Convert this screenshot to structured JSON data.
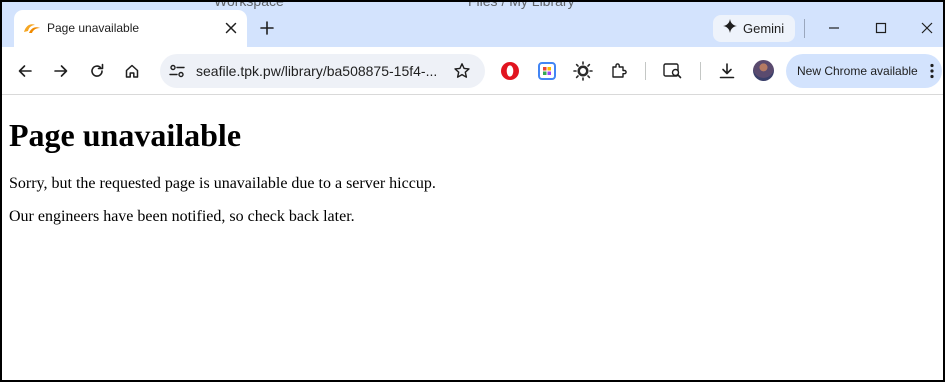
{
  "browser": {
    "background_tabs": [
      "Workspace",
      "Files / My Library"
    ],
    "active_tab": {
      "title": "Page unavailable",
      "favicon": "seafile-icon"
    },
    "gemini_label": "Gemini",
    "address_bar": {
      "url": "seafile.tpk.pw/library/ba508875-15f4-..."
    },
    "update_pill_label": "New Chrome available",
    "colors": {
      "tab_strip": "#d3e3fd",
      "omnibox": "#eef1f7",
      "pill": "#d3e3fd"
    }
  },
  "page": {
    "heading": "Page unavailable",
    "paragraphs": [
      "Sorry, but the requested page is unavailable due to a server hiccup.",
      "Our engineers have been notified, so check back later."
    ]
  }
}
